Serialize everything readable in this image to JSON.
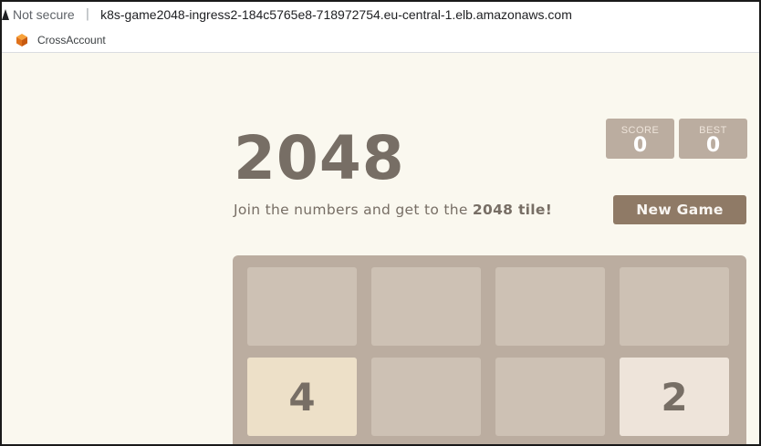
{
  "browser": {
    "security_label": "Not secure",
    "separator": "|",
    "url": "k8s-game2048-ingress2-184c5765e8-718972754.eu-central-1.elb.amazonaws.com",
    "bookmarks": [
      {
        "label": "CrossAccount",
        "icon": "aws-cube-icon"
      }
    ]
  },
  "game": {
    "title": "2048",
    "score_label": "SCORE",
    "score_value": "0",
    "best_label": "BEST",
    "best_value": "0",
    "intro_prefix": "Join the numbers and get to the ",
    "intro_bold": "2048 tile!",
    "new_game_label": "New Game",
    "tiles": [
      {
        "value": "4",
        "row": 2,
        "col": 1
      },
      {
        "value": "2",
        "row": 2,
        "col": 4
      }
    ]
  },
  "colors": {
    "page_bg": "#faf8ef",
    "text": "#776e65",
    "board": "#bbada0",
    "empty_cell": "#cdc1b4",
    "tile_2": "#eee4da",
    "tile_4": "#ede0c8",
    "button": "#8f7a66"
  }
}
